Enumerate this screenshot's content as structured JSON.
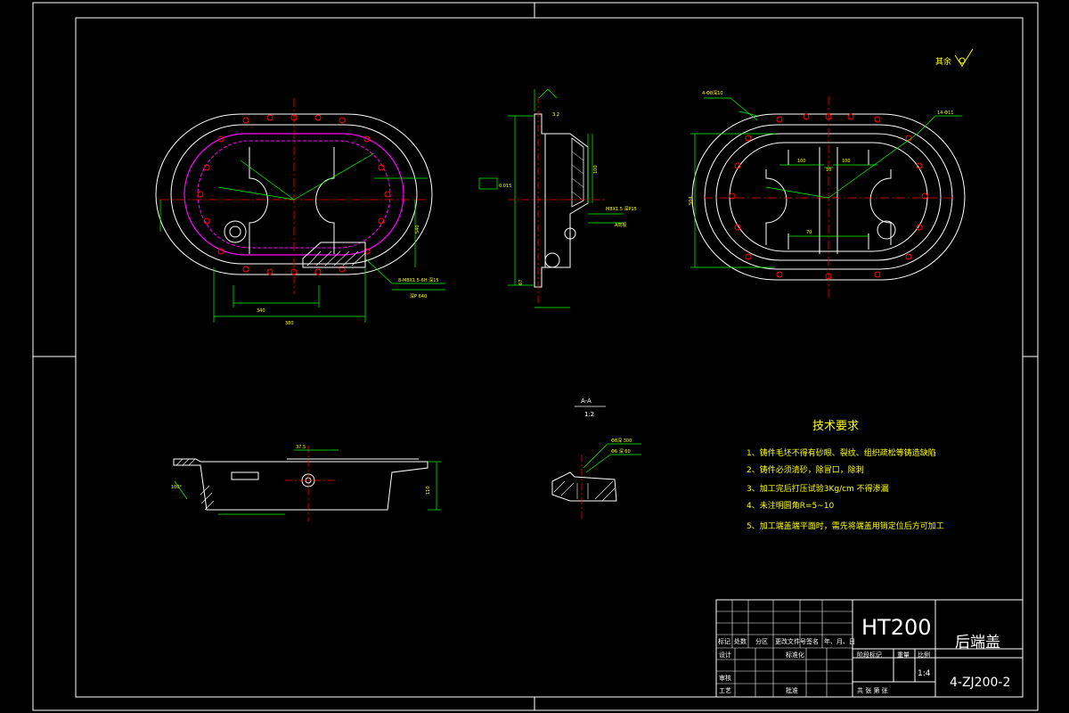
{
  "roughness_note": "其余",
  "tech_requirements": {
    "title": "技术要求",
    "items": [
      "1、铸件毛坯不得有砂眼、裂纹、组织疏松等铸造缺陷",
      "2、铸件必须清砂，除冒口，除刺",
      "3、加工完后打压试验3Kg/cm 不得渗漏",
      "4、未注明圆角R=5~10",
      "5、加工端盖端平面时，需先将端盖用销定位后方可加工"
    ]
  },
  "section_label": {
    "name": "A-A",
    "scale": "1:2"
  },
  "title_block": {
    "material": "HT200",
    "part_name": "后端盖",
    "drawing_no": "4-ZJ200-2",
    "scale": "1:4",
    "header_cols": [
      "标记",
      "处数",
      "分区",
      "更改文件号",
      "签名",
      "年、月、日"
    ],
    "row_labels": [
      "设计",
      "审核",
      "工艺"
    ],
    "std_label": "标准化",
    "approve_label": "批准",
    "stage_label": "阶段标记",
    "weight_label": "重量",
    "scale_label": "比例",
    "sheet_text": "共    张   第    张"
  },
  "annotations": {
    "front_left": {
      "dims": [
        "340",
        "380",
        "540"
      ],
      "callouts": [
        "8-M8X1.5-6H 深15",
        "深P 640"
      ]
    },
    "side": {
      "dims": [
        "3.2",
        "100",
        "67",
        "0.015"
      ],
      "callouts": [
        "M8X1.5 深P15",
        "A向视"
      ]
    },
    "front_right": {
      "dims": [
        "100",
        "10",
        "100",
        "504",
        "70"
      ],
      "callouts": [
        "14-Φ11",
        "4-Φ8深10"
      ]
    },
    "bottom": {
      "dims": [
        "37.5",
        "110",
        "100°"
      ]
    },
    "section": {
      "callouts": [
        "Φ8深 300",
        "Φ6 深 60"
      ]
    }
  }
}
